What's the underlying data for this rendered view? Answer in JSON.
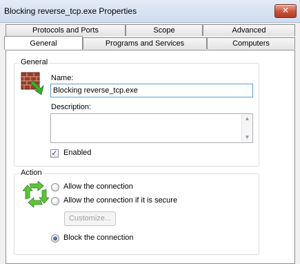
{
  "window": {
    "title": "Blocking reverse_tcp.exe Properties",
    "close_glyph": "✕"
  },
  "tabs": {
    "top_row": [
      "Protocols and Ports",
      "Scope",
      "Advanced"
    ],
    "bottom_row": [
      "General",
      "Programs and Services",
      "Computers"
    ],
    "active": "General"
  },
  "general": {
    "group_label": "General",
    "name_label": "Name:",
    "name_value": "Blocking reverse_tcp.exe",
    "description_label": "Description:",
    "description_value": "",
    "enabled_label": "Enabled",
    "enabled_checked": true
  },
  "action": {
    "group_label": "Action",
    "options": [
      {
        "label": "Allow the connection",
        "checked": false
      },
      {
        "label": "Allow the connection if it is secure",
        "checked": false
      },
      {
        "label": "Block the connection",
        "checked": true
      }
    ],
    "customize_label": "Customize..."
  },
  "icons": {
    "firewall": "firewall-rule-icon",
    "action": "green-arrows-cycle-icon"
  },
  "colors": {
    "titlebar": "#dce7f5",
    "close_button": "#c8513a",
    "focus_border": "#5b9bd5"
  }
}
